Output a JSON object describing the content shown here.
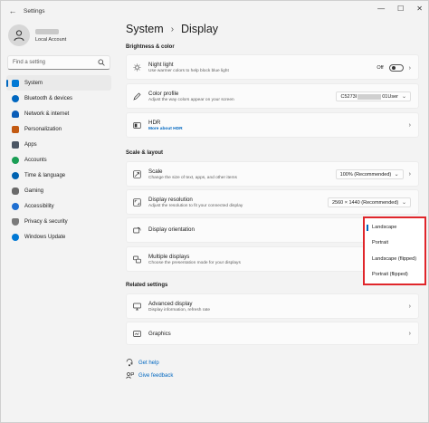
{
  "window": {
    "title": "Settings",
    "controls": [
      "—",
      "☐",
      "✕"
    ]
  },
  "profile": {
    "account_type": "Local Account"
  },
  "search": {
    "placeholder": "Find a setting"
  },
  "nav": [
    {
      "label": "System",
      "icon": "monitor-icon",
      "color": "#0078d4",
      "active": true
    },
    {
      "label": "Bluetooth & devices",
      "icon": "bluetooth-icon",
      "color": "#0067c0"
    },
    {
      "label": "Network & internet",
      "icon": "wifi-icon",
      "color": "#0a5db8"
    },
    {
      "label": "Personalization",
      "icon": "brush-icon",
      "color": "#c35a12"
    },
    {
      "label": "Apps",
      "icon": "apps-icon",
      "color": "#4a5563"
    },
    {
      "label": "Accounts",
      "icon": "person-icon",
      "color": "#1a9e55"
    },
    {
      "label": "Time & language",
      "icon": "globe-clock-icon",
      "color": "#0063b1"
    },
    {
      "label": "Gaming",
      "icon": "gamepad-icon",
      "color": "#6a6a6a"
    },
    {
      "label": "Accessibility",
      "icon": "accessibility-icon",
      "color": "#1f6fd1"
    },
    {
      "label": "Privacy & security",
      "icon": "shield-icon",
      "color": "#7a7a7a"
    },
    {
      "label": "Windows Update",
      "icon": "update-icon",
      "color": "#0078d4"
    }
  ],
  "header": {
    "parent": "System",
    "separator": "›",
    "current": "Display"
  },
  "sections": {
    "brightness": "Brightness & color",
    "scale": "Scale & layout",
    "related": "Related settings"
  },
  "cards": {
    "night_light": {
      "title": "Night light",
      "sub": "Use warmer colors to help block blue light",
      "state": "Off"
    },
    "color_profile": {
      "title": "Color profile",
      "sub": "Adjust the way colors appear on your screen",
      "value_prefix": "C5273I",
      "value_suffix": "01User"
    },
    "hdr": {
      "title": "HDR",
      "sub": "More about HDR"
    },
    "scale": {
      "title": "Scale",
      "sub": "Change the size of text, apps, and other items",
      "value": "100% (Recommended)"
    },
    "resolution": {
      "title": "Display resolution",
      "sub": "Adjust the resolution to fit your connected display",
      "value": "2560 × 1440 (Recommended)"
    },
    "orientation": {
      "title": "Display orientation"
    },
    "multiple": {
      "title": "Multiple displays",
      "sub": "Choose the presentation mode for your displays"
    },
    "advanced": {
      "title": "Advanced display",
      "sub": "Display information, refresh rate"
    },
    "graphics": {
      "title": "Graphics"
    }
  },
  "orientation_menu": {
    "options": [
      "Landscape",
      "Portrait",
      "Landscape (flipped)",
      "Portrait (flipped)"
    ],
    "selected": "Landscape",
    "highlight_color": "#e0262b"
  },
  "help": {
    "get_help": "Get help",
    "feedback": "Give feedback"
  },
  "accent": "#0067c0"
}
